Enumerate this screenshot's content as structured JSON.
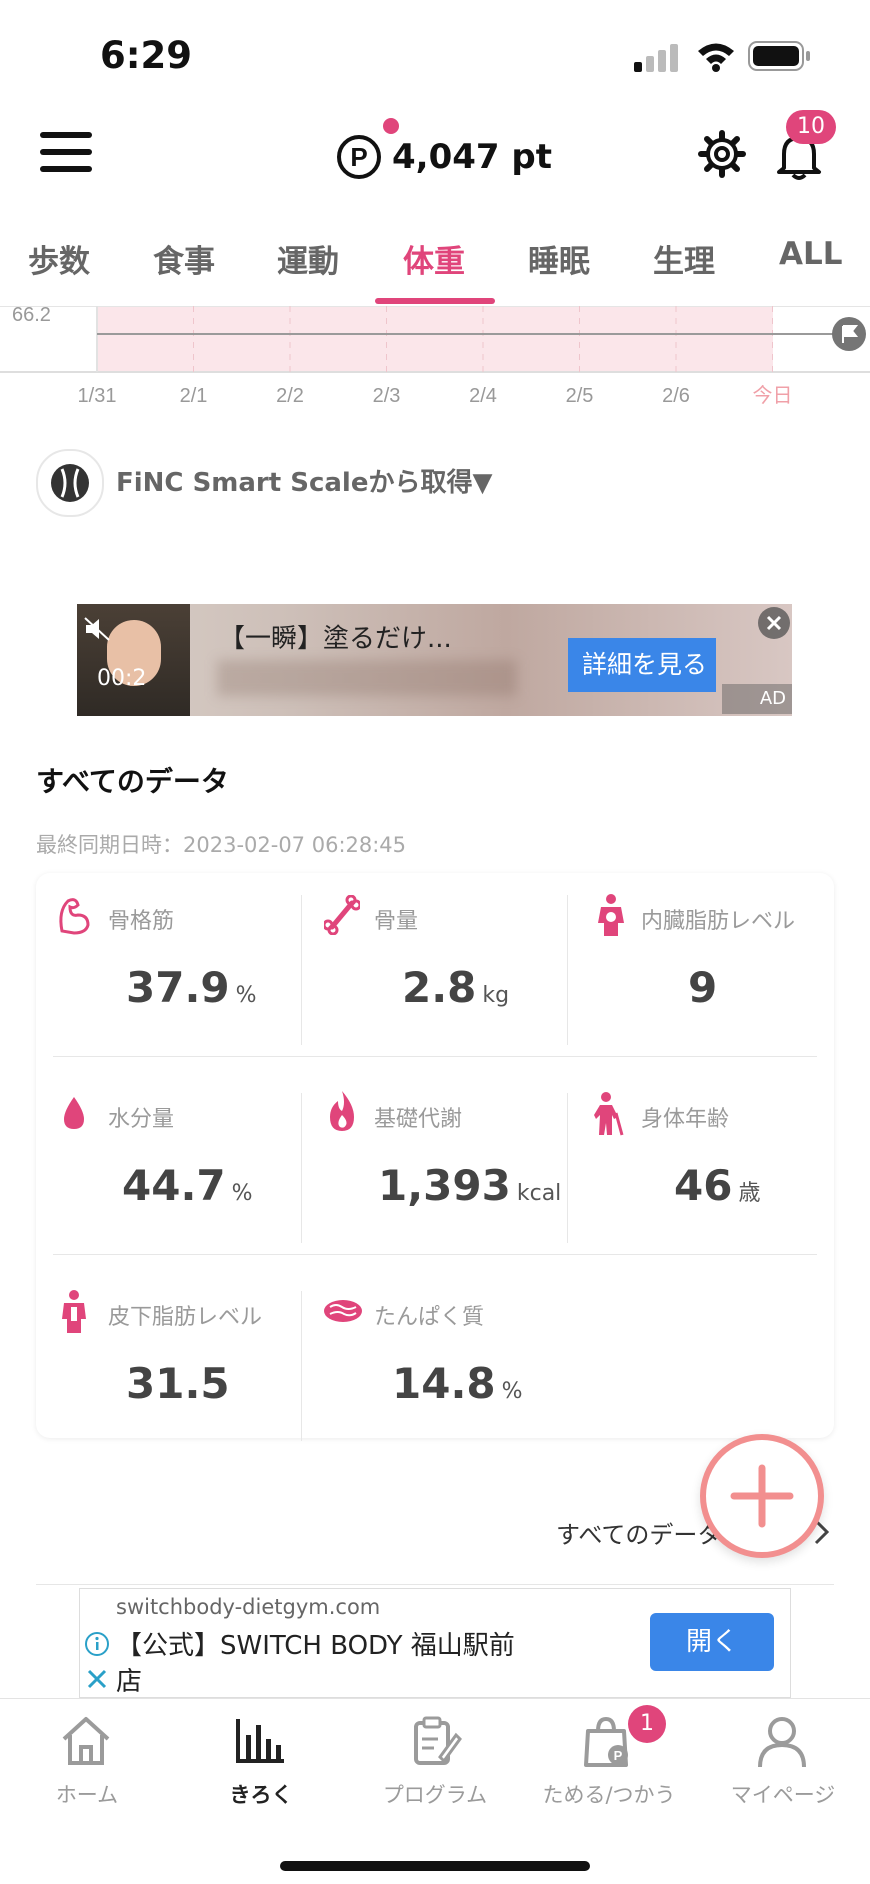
{
  "status_bar": {
    "time": "6:29"
  },
  "header": {
    "points": "4,047 pt",
    "notification_count": "10"
  },
  "tabs": [
    {
      "label": "歩数"
    },
    {
      "label": "食事"
    },
    {
      "label": "運動"
    },
    {
      "label": "体重",
      "active": true
    },
    {
      "label": "睡眠"
    },
    {
      "label": "生理"
    },
    {
      "label": "ALL"
    }
  ],
  "chart_data": {
    "type": "line",
    "y_tick_label": "66.2",
    "categories": [
      "1/31",
      "2/1",
      "2/2",
      "2/3",
      "2/4",
      "2/5",
      "2/6",
      "今日"
    ]
  },
  "source": {
    "text": "FiNC Smart Scaleから取得▼"
  },
  "ad_video": {
    "text": "【一瞬】塗るだけ...",
    "button": "詳細を見る",
    "timer": "00:2",
    "ad_label": "AD"
  },
  "data_section": {
    "title": "すべてのデータ",
    "sync_time": "最終同期日時：2023-02-07 06:28:45",
    "metrics": [
      {
        "label": "骨格筋",
        "value": "37.9",
        "unit": "%"
      },
      {
        "label": "骨量",
        "value": "2.8",
        "unit": "kg"
      },
      {
        "label": "内臓脂肪レベル",
        "value": "9",
        "unit": ""
      },
      {
        "label": "水分量",
        "value": "44.7",
        "unit": "%"
      },
      {
        "label": "基礎代謝",
        "value": "1,393",
        "unit": "kcal"
      },
      {
        "label": "身体年齢",
        "value": "46",
        "unit": "歳"
      },
      {
        "label": "皮下脂肪レベル",
        "value": "31.5",
        "unit": ""
      },
      {
        "label": "たんぱく質",
        "value": "14.8",
        "unit": "%"
      }
    ],
    "see_all": "すべてのデータ"
  },
  "banner_ad": {
    "domain": "switchbody-dietgym.com",
    "title": "【公式】SWITCH BODY 福山駅前店",
    "title_line1": "【公式】SWITCH BODY 福山駅前",
    "title_line2": "店",
    "button": "開く"
  },
  "bottom_nav": [
    {
      "label": "ホーム"
    },
    {
      "label": "きろく",
      "active": true
    },
    {
      "label": "プログラム"
    },
    {
      "label": "ためる/つかう",
      "badge": "1"
    },
    {
      "label": "マイページ"
    }
  ],
  "colors": {
    "accent": "#e0457b",
    "fab": "#f28f8f",
    "ad_button": "#3a86e8"
  }
}
